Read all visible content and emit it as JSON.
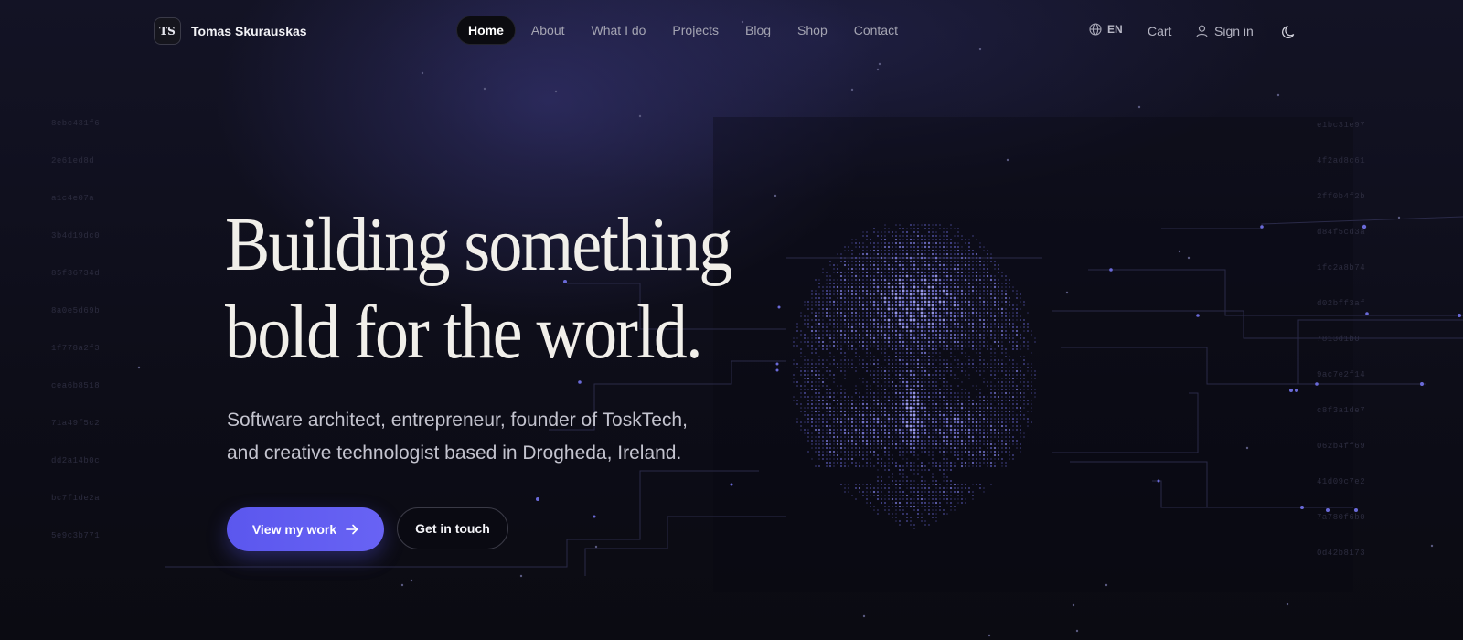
{
  "colors": {
    "background": "#0c0c14",
    "accent": "#5b57ee",
    "dots": "#7b7bea",
    "headline": "#f1efea"
  },
  "brand": {
    "logo_text": "TS",
    "name": "Tomas Skurauskas"
  },
  "nav": {
    "links": [
      {
        "label": "Home",
        "active": true
      },
      {
        "label": "About"
      },
      {
        "label": "What I do"
      },
      {
        "label": "Projects"
      },
      {
        "label": "Blog"
      },
      {
        "label": "Shop"
      },
      {
        "label": "Contact"
      }
    ],
    "language": "EN",
    "language_icon": "globe-icon",
    "cart": "Cart",
    "sign_in": "Sign in",
    "sign_in_icon": "user-icon",
    "theme_icon": "moon-icon"
  },
  "hero": {
    "headline_line1": "Building something",
    "headline_line2": "bold for the world.",
    "subline_line1": "Software architect, entrepreneur, founder of ToskTech,",
    "subline_line2": "and creative technologist based in Drogheda, Ireland.",
    "primary_cta": "View my work",
    "primary_cta_icon": "arrow-right-icon",
    "secondary_cta": "Get in touch",
    "portrait_icon": "dot-matrix-face-portrait"
  },
  "decor": {
    "hex_left": [
      "8ebc431f6",
      "2e61ed8d",
      "a1c4e07a",
      "3b4d19dc0",
      "85f36734d",
      "8a0e5d69b",
      "1f778a2f3",
      "cea6b8518",
      "71a49f5c2",
      "dd2a14b0c",
      "bc7f1de2a",
      "5e9c3b771"
    ],
    "hex_right": [
      "e1bc31e97",
      "4f2ad8c61",
      "2ff0b4f2b",
      "d84f5cd3a",
      "1fc2a8b74",
      "d02bff3af",
      "7813d1b0",
      "9ac7e2f14",
      "c8f3a1de7",
      "062b4ff69",
      "41d09c7e2",
      "7a780f6b0",
      "0d42b8173"
    ]
  }
}
